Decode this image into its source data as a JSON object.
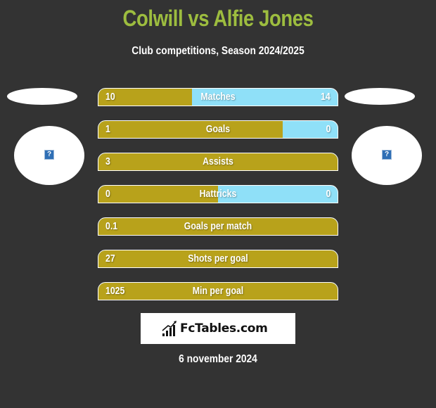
{
  "header": {
    "title": "Colwill vs Alfie Jones",
    "subtitle": "Club competitions, Season 2024/2025"
  },
  "players": {
    "left": {
      "name": "Colwill",
      "avatar_icon": "image-placeholder-icon"
    },
    "right": {
      "name": "Alfie Jones",
      "avatar_icon": "image-placeholder-icon"
    }
  },
  "colors": {
    "background": "#333333",
    "title": "#9dbd3f",
    "left_bar": "#b8a21b",
    "right_bar": "#8fe0f8",
    "text": "#ffffff"
  },
  "stats": [
    {
      "label": "Matches",
      "left": "10",
      "right": "14",
      "left_share": 0.39
    },
    {
      "label": "Goals",
      "left": "1",
      "right": "0",
      "left_share": 0.77
    },
    {
      "label": "Assists",
      "left": "3",
      "right": "",
      "left_share": 1.0
    },
    {
      "label": "Hattricks",
      "left": "0",
      "right": "0",
      "left_share": 0.5
    },
    {
      "label": "Goals per match",
      "left": "0.1",
      "right": "",
      "left_share": 1.0
    },
    {
      "label": "Shots per goal",
      "left": "27",
      "right": "",
      "left_share": 1.0
    },
    {
      "label": "Min per goal",
      "left": "1025",
      "right": "",
      "left_share": 1.0
    }
  ],
  "footer": {
    "logo_text": "FcTables.com",
    "logo_icon": "bar-chart-icon",
    "date": "6 november 2024"
  }
}
